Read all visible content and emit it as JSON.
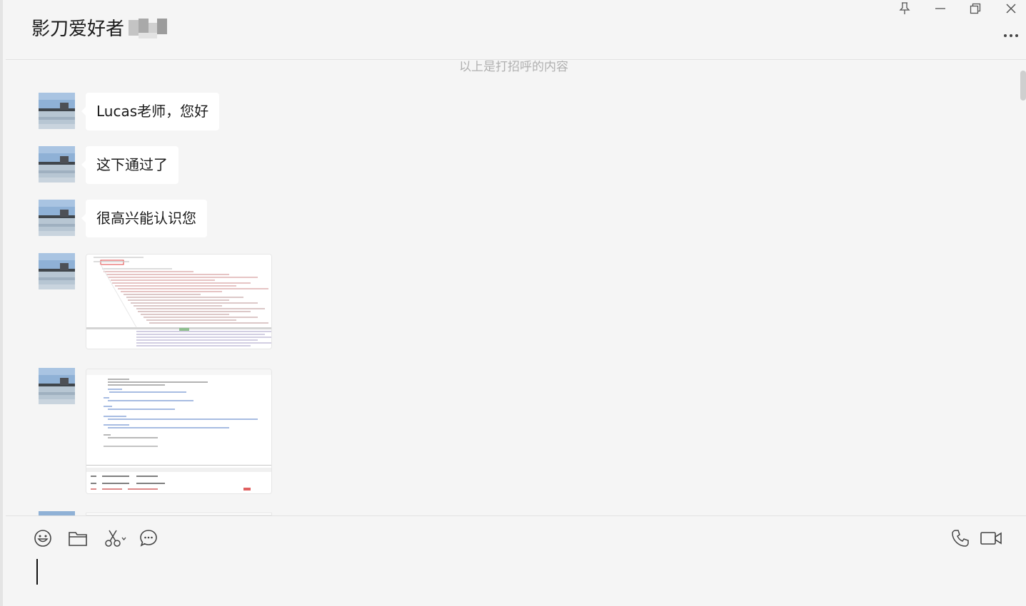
{
  "header": {
    "contact_name": "影刀爱好者"
  },
  "window_controls": {
    "icons": [
      "pin-icon",
      "minimize-icon",
      "restore-icon",
      "close-icon"
    ]
  },
  "chat": {
    "system_note": "以上是打招呼的内容",
    "messages": [
      {
        "type": "text",
        "text": "Lucas老师，您好"
      },
      {
        "type": "text",
        "text": "这下通过了"
      },
      {
        "type": "text",
        "text": "很高兴能认识您"
      },
      {
        "type": "image",
        "content": "code-screenshot"
      },
      {
        "type": "image",
        "content": "document-screenshot"
      }
    ]
  },
  "composer": {
    "left_tools": [
      "emoji-icon",
      "folder-icon",
      "scissors-icon",
      "chat-history-icon"
    ],
    "right_tools": [
      "phone-icon",
      "video-call-icon"
    ],
    "input_value": ""
  },
  "colors": {
    "background": "#f5f5f5",
    "bubble": "#ffffff",
    "text": "#1a1a1a",
    "system_note": "#b0b0b0"
  }
}
